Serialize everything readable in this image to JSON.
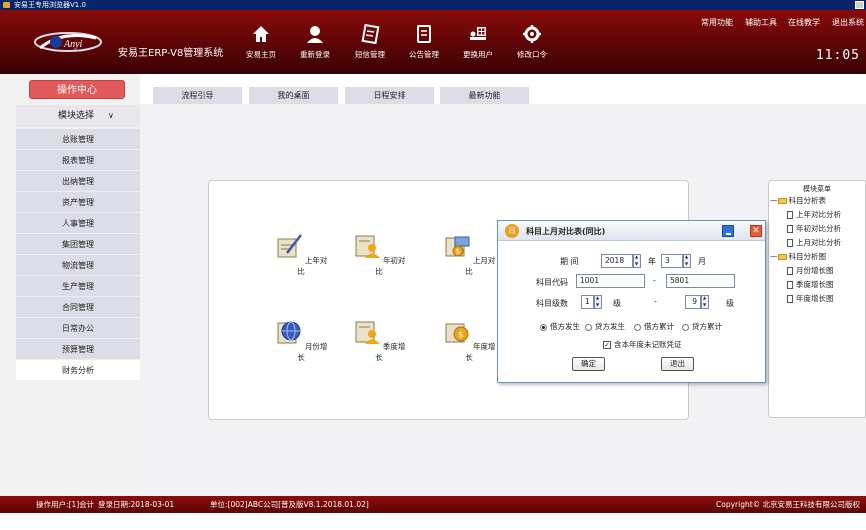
{
  "window": {
    "title": "安易王专用浏览器V1.0"
  },
  "header": {
    "brand_logo_text": "Anyi",
    "brand_title": "安易王ERP-V8管理系统",
    "nav": [
      {
        "label": "安易主页",
        "icon": "home-icon"
      },
      {
        "label": "重新登录",
        "icon": "user-icon"
      },
      {
        "label": "短信管理",
        "icon": "message-icon"
      },
      {
        "label": "公告管理",
        "icon": "notice-icon"
      },
      {
        "label": "更换用户",
        "icon": "switch-user-icon"
      },
      {
        "label": "修改口令",
        "icon": "settings-icon"
      }
    ],
    "top_links": [
      "常用功能",
      "辅助工具",
      "在线教学",
      "退出系统"
    ],
    "clock": "11:05"
  },
  "sidebar": {
    "op_center": "操作中心",
    "module_select": "模块选择",
    "items": [
      "总账管理",
      "报表管理",
      "出纳管理",
      "资产管理",
      "人事管理",
      "集团管理",
      "物流管理",
      "生产管理",
      "合同管理",
      "日常办公",
      "预算管理",
      "财务分析"
    ],
    "active_index": 11
  },
  "tabs": [
    "流程引导",
    "我的桌面",
    "日程安排",
    "最新功能"
  ],
  "functions": [
    {
      "label": "上年对比",
      "icon": "pen-document-icon"
    },
    {
      "label": "年初对比",
      "icon": "person-document-icon"
    },
    {
      "label": "上月对比",
      "icon": "money-document-icon"
    },
    {
      "label": "月份增长",
      "icon": "globe-document-icon"
    },
    {
      "label": "季度增长",
      "icon": "person-document-icon"
    },
    {
      "label": "年度增长",
      "icon": "money-document-icon"
    }
  ],
  "module_menu": {
    "title": "模块菜单",
    "groups": [
      {
        "label": "科目分析表",
        "items": [
          "上年对比分析",
          "年初对比分析",
          "上月对比分析"
        ]
      },
      {
        "label": "科目分析图",
        "items": [
          "月份增长图",
          "季度增长图",
          "年度增长图"
        ]
      }
    ]
  },
  "dialog": {
    "title": "科目上月对比表(同比)",
    "period_label": "期   间",
    "year": "2018",
    "year_unit": "年",
    "month": "3",
    "month_unit": "月",
    "code_label": "科目代码",
    "code_from": "1001",
    "code_to": "5801",
    "level_label": "科目级数",
    "level_from": "1",
    "level_to": "9",
    "level_unit": "级",
    "dash": "-",
    "radios": [
      "借方发生",
      "贷方发生",
      "借方累计",
      "贷方累计"
    ],
    "radio_selected": 0,
    "checkbox_label": "含本年度未记账凭证",
    "checkbox_checked": true,
    "ok": "确定",
    "exit": "退出",
    "badge": "同"
  },
  "status": {
    "user": "操作用户:[1]会计",
    "login_date": "登录日期:2018-03-01",
    "unit": "单位:[002]ABC公司[普及版V8.1.2018.01.02]",
    "copyright": "Copyright© 北京安易王科技有限公司版权所有"
  }
}
